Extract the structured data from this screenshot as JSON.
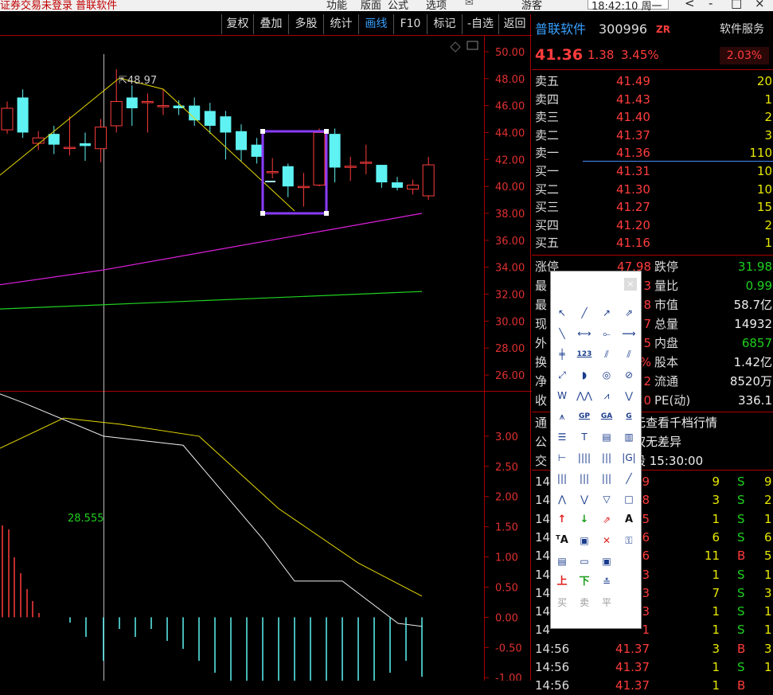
{
  "window": {
    "title": "证券交易未登录  普联软件",
    "menus": [
      "功能",
      "版面",
      "公式",
      "选项"
    ],
    "user": "游客",
    "clock": "18:42:10 周一",
    "controls": [
      "<",
      "-",
      "□",
      "×"
    ]
  },
  "toolbar": {
    "buttons": [
      {
        "label": "复权",
        "active": false
      },
      {
        "label": "叠加",
        "active": false
      },
      {
        "label": "多股",
        "active": false
      },
      {
        "label": "统计",
        "active": false
      },
      {
        "label": "画线",
        "active": true
      },
      {
        "label": "F10",
        "active": false
      },
      {
        "label": "标记",
        "active": false
      },
      {
        "label": "-自选",
        "active": false
      },
      {
        "label": "返回",
        "active": false
      }
    ]
  },
  "stock": {
    "name": "普联软件",
    "code": "300996",
    "tag": "ZR",
    "price": "41.36",
    "change": "1.38",
    "pct": "3.45%",
    "service": "软件服务",
    "service_pct": "2.03%"
  },
  "order_book": {
    "asks": [
      {
        "label": "卖五",
        "price": "41.49",
        "vol": "20"
      },
      {
        "label": "卖四",
        "price": "41.43",
        "vol": "1"
      },
      {
        "label": "卖三",
        "price": "41.40",
        "vol": "2"
      },
      {
        "label": "卖二",
        "price": "41.37",
        "vol": "3"
      },
      {
        "label": "卖一",
        "price": "41.36",
        "vol": "110"
      }
    ],
    "bids": [
      {
        "label": "买一",
        "price": "41.31",
        "vol": "10"
      },
      {
        "label": "买二",
        "price": "41.30",
        "vol": "10"
      },
      {
        "label": "买三",
        "price": "41.27",
        "vol": "15"
      },
      {
        "label": "买四",
        "price": "41.20",
        "vol": "2"
      },
      {
        "label": "买五",
        "price": "41.16",
        "vol": "1"
      }
    ]
  },
  "stats": [
    {
      "l1": "涨停",
      "v1": "47.98",
      "l2": "跌停",
      "v2": "31.98"
    },
    {
      "l1": "最",
      "v1": "3",
      "l2": "量比",
      "v2": "0.99"
    },
    {
      "l1": "最",
      "v1": "8",
      "l2": "市值",
      "v2": "58.7亿"
    },
    {
      "l1": "现",
      "v1": "7",
      "l2": "总量",
      "v2": "14932"
    },
    {
      "l1": "外",
      "v1": "5",
      "l2": "内盘",
      "v2": "6857"
    },
    {
      "l1": "换",
      "v1": "%",
      "l2": "股本",
      "v2": "1.42亿"
    },
    {
      "l1": "净",
      "v1": "2",
      "l2": "流通",
      "v2": "8520万"
    },
    {
      "l1": "收",
      "v1": "0",
      "l2": "PE(动)",
      "v2": "336.1"
    }
  ],
  "notices": [
    {
      "l": "通",
      "t": "无查看千档行情"
    },
    {
      "l": "公",
      "t": "权无差异"
    },
    {
      "l": "交",
      "t": "段 15:30:00"
    }
  ],
  "trades": [
    {
      "time": "14",
      "price": "9",
      "vol": "9",
      "bs": "S",
      "n": "9"
    },
    {
      "time": "14",
      "price": "8",
      "vol": "3",
      "bs": "S",
      "n": "2"
    },
    {
      "time": "14",
      "price": "5",
      "vol": "1",
      "bs": "S",
      "n": "1"
    },
    {
      "time": "14",
      "price": "6",
      "vol": "6",
      "bs": "S",
      "n": "6"
    },
    {
      "time": "14",
      "price": "6",
      "vol": "11",
      "bs": "B",
      "n": "5"
    },
    {
      "time": "14",
      "price": "3",
      "vol": "1",
      "bs": "S",
      "n": "1"
    },
    {
      "time": "14",
      "price": "3",
      "vol": "7",
      "bs": "S",
      "n": "3"
    },
    {
      "time": "14",
      "price": "3",
      "vol": "1",
      "bs": "S",
      "n": "1"
    },
    {
      "time": "14",
      "price": "1",
      "vol": "1",
      "bs": "S",
      "n": "1"
    },
    {
      "time": "14:56",
      "price": "41.37",
      "vol": "3",
      "bs": "B",
      "n": "3"
    },
    {
      "time": "14:56",
      "price": "41.37",
      "vol": "1",
      "bs": "S",
      "n": "1"
    },
    {
      "time": "14:56",
      "price": "41.37",
      "vol": "1",
      "bs": "B",
      "n": ""
    }
  ],
  "chart_data": {
    "type": "candlestick",
    "price_axis": {
      "ticks": [
        "50.00",
        "48.00",
        "46.00",
        "44.00",
        "42.00",
        "40.00",
        "38.00",
        "36.00",
        "34.00",
        "32.00",
        "30.00",
        "28.00",
        "26.00"
      ],
      "ylim": [
        25,
        51
      ]
    },
    "price_marker": "48.97",
    "candles": [
      {
        "o": 44.2,
        "c": 45.8,
        "h": 46.3,
        "l": 43.9
      },
      {
        "o": 46.6,
        "c": 44.0,
        "h": 47.2,
        "l": 43.6
      },
      {
        "o": 43.2,
        "c": 43.6,
        "h": 44.1,
        "l": 42.7
      },
      {
        "o": 43.9,
        "c": 43.1,
        "h": 44.5,
        "l": 42.4
      },
      {
        "o": 42.9,
        "c": 42.9,
        "h": 45.2,
        "l": 42.3
      },
      {
        "o": 43.2,
        "c": 43.0,
        "h": 44.0,
        "l": 41.9
      },
      {
        "o": 42.8,
        "c": 44.4,
        "h": 45.0,
        "l": 41.8
      },
      {
        "o": 44.5,
        "c": 46.3,
        "h": 48.7,
        "l": 44.0
      },
      {
        "o": 46.6,
        "c": 45.8,
        "h": 47.5,
        "l": 44.5
      },
      {
        "o": 46.3,
        "c": 46.3,
        "h": 46.9,
        "l": 44.0
      },
      {
        "o": 46.0,
        "c": 46.0,
        "h": 47.2,
        "l": 45.3
      },
      {
        "o": 46.0,
        "c": 45.8,
        "h": 46.4,
        "l": 45.3
      },
      {
        "o": 46.0,
        "c": 44.9,
        "h": 46.6,
        "l": 44.5
      },
      {
        "o": 45.6,
        "c": 44.5,
        "h": 46.2,
        "l": 43.9
      },
      {
        "o": 45.2,
        "c": 44.0,
        "h": 45.6,
        "l": 42.0
      },
      {
        "o": 44.1,
        "c": 42.7,
        "h": 44.6,
        "l": 41.9
      },
      {
        "o": 43.1,
        "c": 42.2,
        "h": 43.6,
        "l": 41.7
      },
      {
        "o": 41.1,
        "c": 41.1,
        "h": 42.1,
        "l": 40.6
      },
      {
        "o": 41.5,
        "c": 40.0,
        "h": 41.7,
        "l": 39.2
      },
      {
        "o": 40.0,
        "c": 40.0,
        "h": 41.0,
        "l": 38.5
      },
      {
        "o": 40.1,
        "c": 44.0,
        "h": 44.3,
        "l": 40.0
      },
      {
        "o": 43.9,
        "c": 41.4,
        "h": 44.3,
        "l": 40.3
      },
      {
        "o": 41.5,
        "c": 41.5,
        "h": 42.2,
        "l": 40.4
      },
      {
        "o": 41.8,
        "c": 41.8,
        "h": 43.1,
        "l": 40.9
      },
      {
        "o": 41.6,
        "c": 40.3,
        "h": 41.6,
        "l": 39.9
      },
      {
        "o": 40.3,
        "c": 39.9,
        "h": 40.7,
        "l": 39.7
      },
      {
        "o": 39.8,
        "c": 40.1,
        "h": 40.5,
        "l": 39.4
      },
      {
        "o": 39.3,
        "c": 41.6,
        "h": 42.2,
        "l": 39.0
      }
    ],
    "ma_magenta": [
      [
        0,
        32.7
      ],
      [
        130,
        33.8
      ],
      [
        530,
        38.0
      ]
    ],
    "ma_green": [
      [
        0,
        30.9
      ],
      [
        530,
        32.2
      ]
    ],
    "indicator": {
      "ticks": [
        "3.00",
        "2.50",
        "2.00",
        "1.50",
        "1.00",
        "0.50",
        "0.00",
        "-0.50",
        "-1.00"
      ],
      "ylim": [
        -1.05,
        3.5
      ],
      "label": "28.555",
      "white_line": [
        [
          0,
          3.7
        ],
        [
          30,
          3.55
        ],
        [
          130,
          3.0
        ],
        [
          230,
          2.85
        ],
        [
          330,
          1.3
        ],
        [
          370,
          0.6
        ],
        [
          430,
          0.6
        ],
        [
          500,
          -0.1
        ],
        [
          530,
          -0.15
        ]
      ],
      "yellow_line": [
        [
          0,
          2.8
        ],
        [
          80,
          3.3
        ],
        [
          150,
          3.2
        ],
        [
          250,
          3.0
        ],
        [
          350,
          1.8
        ],
        [
          450,
          0.9
        ],
        [
          530,
          0.35
        ]
      ]
    }
  },
  "draw_tools": {
    "rows": [
      [
        "↖",
        "╱",
        "↗",
        "⇗"
      ],
      [
        "╲",
        "⟷",
        "⟜",
        "⟿"
      ],
      [
        "╪",
        "123",
        "⫽",
        "⫽"
      ],
      [
        "⤢",
        "◗",
        "◎",
        "⊘"
      ],
      [
        "W",
        "⋀⋀",
        "⩘",
        "⋁"
      ],
      [
        "⩚",
        "GP",
        "GA",
        "G"
      ],
      [
        "☰",
        "T",
        "▤",
        "▥"
      ],
      [
        "⊢",
        "||||",
        "|||",
        "|G|"
      ],
      [
        "|||",
        "|||",
        "|||",
        "╱"
      ],
      [
        "⋀",
        "⋁",
        "▽",
        "□"
      ],
      [
        "↑",
        "↓",
        "⇗",
        "A"
      ],
      [
        "ᵀA",
        "▣",
        "✕",
        "⚿"
      ],
      [
        "▤",
        "▭",
        "▣",
        ""
      ],
      [
        "上",
        "下",
        "≛",
        ""
      ],
      [
        "买",
        "卖",
        "平",
        ""
      ]
    ]
  }
}
